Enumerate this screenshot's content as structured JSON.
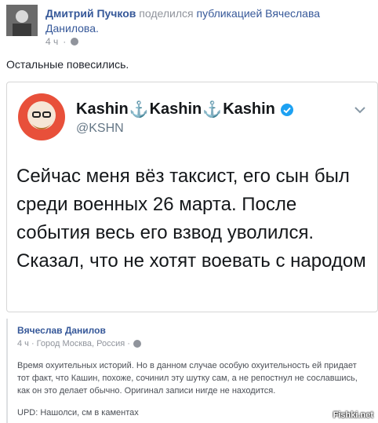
{
  "header": {
    "author": "Дмитрий Пучков",
    "action": "поделился",
    "shared_label": "публикацией Вячеслава Данилова.",
    "time": "4 ч",
    "privacy_icon": "globe-icon"
  },
  "post": {
    "text": "Остальные повесились."
  },
  "tweet": {
    "name_parts": [
      "Kashin",
      "Kashin",
      "Kashin"
    ],
    "anchor_glyph": "⚓",
    "handle": "@KSHN",
    "text": "Сейчас меня вёз таксист, его сын был среди военных 26 марта. После события весь его взвод уволился. Сказал, что не хотят воевать с народом",
    "verified_color": "#1da1f2"
  },
  "quote": {
    "author": "Вячеслав Данилов",
    "meta": "4 ч · Город Москва, Россия ·",
    "body": "Время охуительных историй. Но в данном случае особую охуительность ей придает тот факт, что Кашин, похоже, сочинил эту шутку сам, а не репостнул не сославшись, как он это делает обычно. Оригинал записи нигде не находится.",
    "update": "UPD: Нашолси, см в каментах"
  },
  "watermark": "Fishki.net"
}
